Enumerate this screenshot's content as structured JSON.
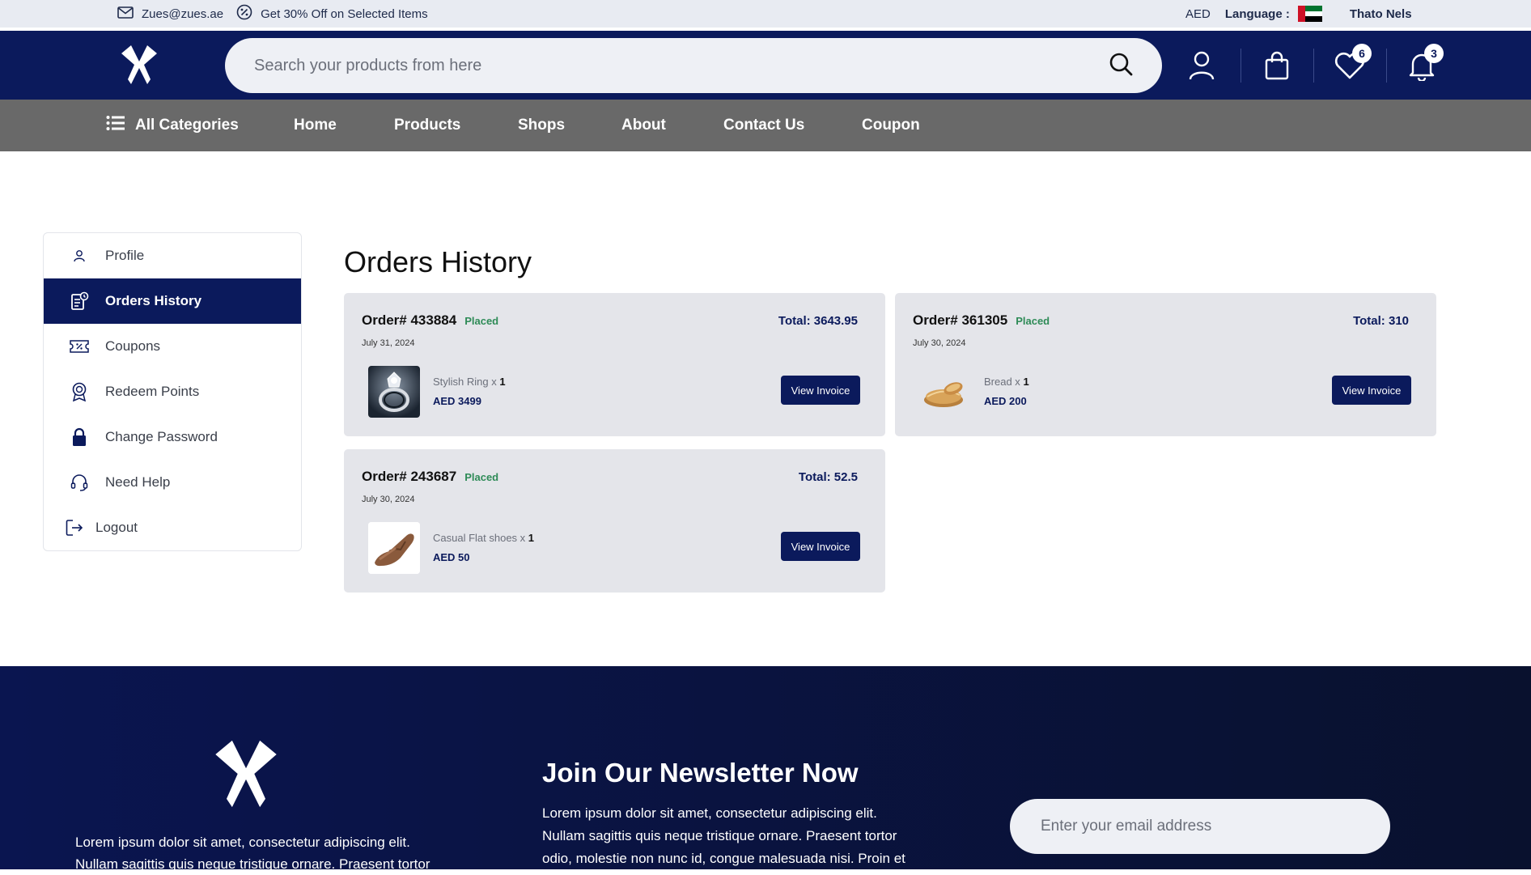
{
  "topbar": {
    "email": "Zues@zues.ae",
    "promo": "Get 30% Off on Selected Items",
    "currency": "AED",
    "language_label": "Language :",
    "user_name": "Thato Nels"
  },
  "header": {
    "search_placeholder": "Search your products from here",
    "wishlist_count": "6",
    "notifications_count": "3"
  },
  "nav": {
    "all_categories": "All Categories",
    "items": [
      "Home",
      "Products",
      "Shops",
      "About",
      "Contact Us",
      "Coupon"
    ]
  },
  "sidebar": {
    "items": [
      {
        "label": "Profile",
        "icon": "user-icon"
      },
      {
        "label": "Orders History",
        "icon": "orders-icon",
        "active": true
      },
      {
        "label": "Coupons",
        "icon": "coupon-icon"
      },
      {
        "label": "Redeem Points",
        "icon": "badge-icon"
      },
      {
        "label": "Change Password",
        "icon": "lock-icon"
      },
      {
        "label": "Need Help",
        "icon": "headset-icon"
      },
      {
        "label": "Logout",
        "icon": "logout-icon"
      }
    ]
  },
  "main": {
    "title": "Orders History",
    "orders": [
      {
        "id": "Order# 433884",
        "status": "Placed",
        "date": "July 31, 2024",
        "total": "Total: 3643.95",
        "product": "Stylish Ring x",
        "qty": "1",
        "price": "AED 3499",
        "button": "View Invoice"
      },
      {
        "id": "Order# 361305",
        "status": "Placed",
        "date": "July 30, 2024",
        "total": "Total: 310",
        "product": "Bread x",
        "qty": "1",
        "price": "AED 200",
        "button": "View Invoice"
      },
      {
        "id": "Order# 243687",
        "status": "Placed",
        "date": "July 30, 2024",
        "total": "Total: 52.5",
        "product": "Casual Flat shoes x",
        "qty": "1",
        "price": "AED 50",
        "button": "View Invoice"
      }
    ]
  },
  "footer": {
    "about_text": "Lorem ipsum dolor sit amet, consectetur adipiscing elit. Nullam sagittis quis neque tristique ornare. Praesent tortor",
    "newsletter_title": "Join Our Newsletter Now",
    "newsletter_text": "Lorem ipsum dolor sit amet, consectetur adipiscing elit. Nullam sagittis quis neque tristique ornare. Praesent tortor odio, molestie non nunc id, congue malesuada nisi. Proin et",
    "email_placeholder": "Enter your email address"
  },
  "colors": {
    "brand": "#0b1a5c",
    "nav_bg": "#696969",
    "status_placed": "#2e8b57"
  }
}
